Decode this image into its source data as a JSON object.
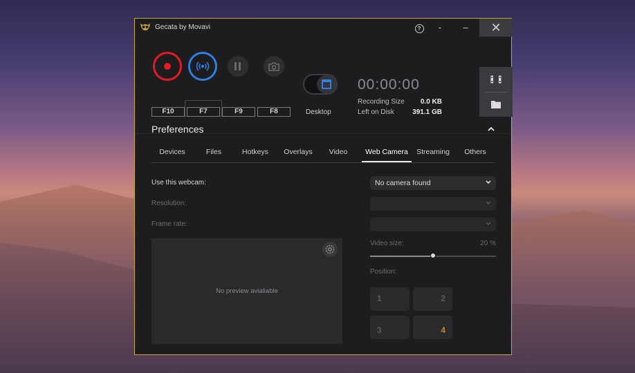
{
  "window": {
    "title": "Gecata by Movavi",
    "help_label": "?",
    "minimize1_label": "-",
    "minimize2_label": "–",
    "close_label": "✕"
  },
  "toolbar": {
    "hotkeys": [
      "F10",
      "F7",
      "F9",
      "F8"
    ],
    "mode_label": "Desktop",
    "timer": "00:00:00",
    "recording_size_label": "Recording Size",
    "recording_size_value": "0.0 KB",
    "left_on_disk_label": "Left on Disk",
    "left_on_disk_value": "391.1 GB"
  },
  "preferences": {
    "title": "Preferences",
    "tabs": [
      "Devices",
      "Files",
      "Hotkeys",
      "Overlays",
      "Video",
      "Web Camera",
      "Streaming",
      "Others"
    ],
    "active_tab": "Web Camera"
  },
  "webcam": {
    "use_label": "Use this webcam:",
    "use_value": "No camera found",
    "resolution_label": "Resolution:",
    "resolution_value": "",
    "frame_rate_label": "Frame rate:",
    "frame_rate_value": "",
    "preview_message": "No preview avialiable",
    "video_size_label": "Video size:",
    "video_size_value": "20 %",
    "video_size_fraction": 0.5,
    "position_label": "Position:",
    "positions": [
      "1",
      "2",
      "3",
      "4"
    ],
    "selected_position": "4"
  },
  "colors": {
    "record": "#e01b24",
    "stream": "#2f7fe0",
    "window_border": "#c9a53a",
    "selected_position": "#b88a2a"
  }
}
